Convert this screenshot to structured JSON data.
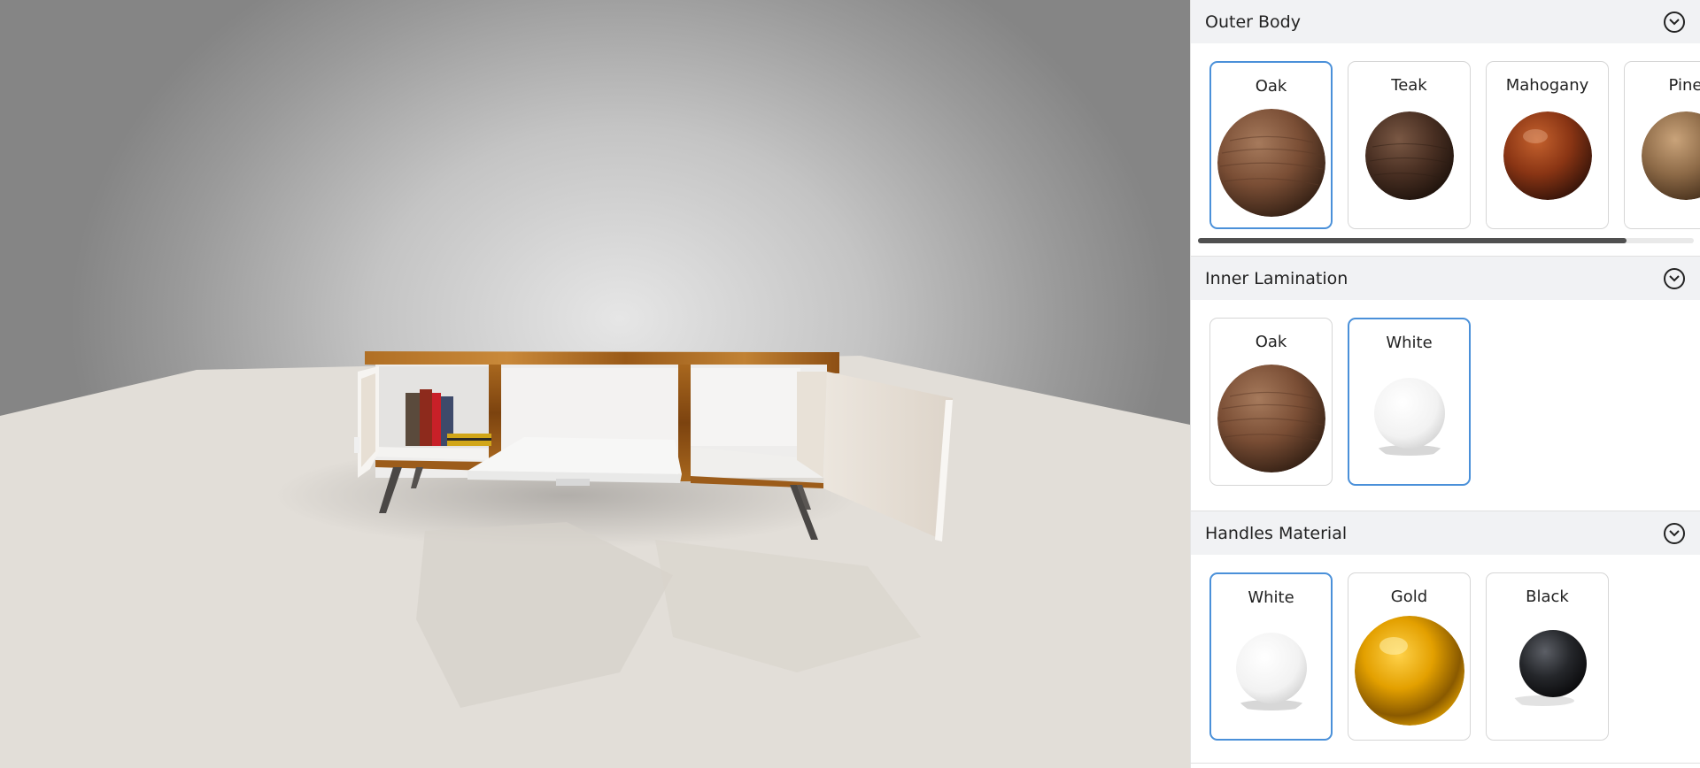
{
  "viewport": {
    "scene": "3d-furniture-preview",
    "colors": {
      "wood": "#a8671e",
      "white_panel": "#f4f2ef",
      "floor": "#e2ded8"
    }
  },
  "panel": {
    "sections": [
      {
        "title": "Outer Body",
        "options": [
          {
            "label": "Oak",
            "selected": true,
            "swatch": "wood-oak"
          },
          {
            "label": "Teak",
            "selected": false,
            "swatch": "wood-teak"
          },
          {
            "label": "Mahogany",
            "selected": false,
            "swatch": "wood-mahogany"
          },
          {
            "label": "Pine",
            "selected": false,
            "swatch": "wood-pine"
          }
        ]
      },
      {
        "title": "Inner Lamination",
        "options": [
          {
            "label": "Oak",
            "selected": false,
            "swatch": "wood-oak"
          },
          {
            "label": "White",
            "selected": true,
            "swatch": "white"
          }
        ]
      },
      {
        "title": "Handles Material",
        "options": [
          {
            "label": "White",
            "selected": true,
            "swatch": "white"
          },
          {
            "label": "Gold",
            "selected": false,
            "swatch": "gold"
          },
          {
            "label": "Black",
            "selected": false,
            "swatch": "black"
          }
        ]
      }
    ],
    "accent_color": "#4a90d9",
    "header_bg": "#f1f2f4"
  }
}
